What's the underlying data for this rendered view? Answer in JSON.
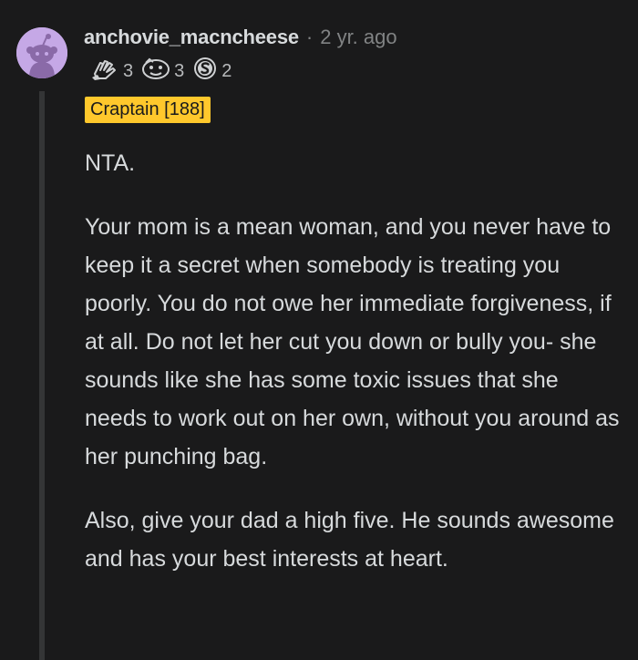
{
  "comment": {
    "username": "anchovie_macncheese",
    "separator": "·",
    "timestamp": "2 yr. ago",
    "awards": [
      {
        "icon": "hands-award-icon",
        "count": "3"
      },
      {
        "icon": "face-award-icon",
        "count": "3"
      },
      {
        "icon": "silver-coin-award-icon",
        "count": "2"
      }
    ],
    "flair": "Craptain [188]",
    "paragraphs": [
      "NTA.",
      "Your mom is a mean woman, and you never have to keep it a secret when somebody is treating you poorly. You do not owe her immediate forgiveness, if at all. Do not let her cut you down or bully you- she sounds like she has some toxic issues that she needs to work out on her own, without you around as her punching bag.",
      "Also, give your dad a high five. He sounds awesome and has your best interests at heart."
    ]
  },
  "colors": {
    "background": "#1a1a1b",
    "text": "#d7dadc",
    "muted": "#818384",
    "flair_bg": "#ffc82c",
    "avatar_bg": "#c5a8e6",
    "thread_line": "#343536"
  }
}
